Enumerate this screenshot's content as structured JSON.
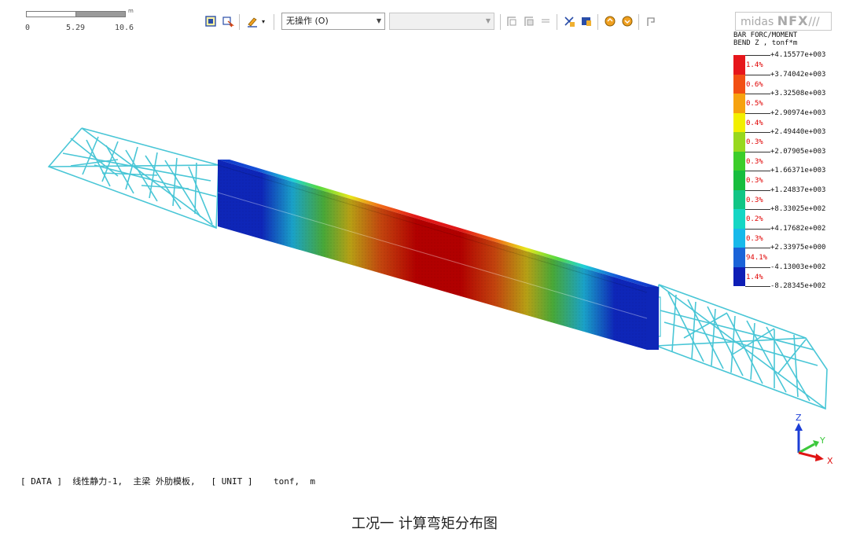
{
  "scale": {
    "labels": [
      "0",
      "5.29",
      "10.6"
    ],
    "unit": "m"
  },
  "toolbar": {
    "operation_value": "无操作 (O)",
    "icons": [
      "box-select-icon",
      "wireframe-icon",
      "edit-view-icon",
      "view-left-icon",
      "view-right-icon",
      "view-list-icon",
      "clear-icon",
      "select-element-icon",
      "rotate-icon",
      "rotate2-icon",
      "pin-icon"
    ]
  },
  "logo": {
    "prefix": "midas ",
    "brand": "NFX",
    "suffix": "///"
  },
  "legend": {
    "title_line1": "BAR FORC/MOMENT",
    "title_line2": "BEND Z , tonf*m",
    "values": [
      "+4.15577e+003",
      "+3.74042e+003",
      "+3.32508e+003",
      "+2.90974e+003",
      "+2.49440e+003",
      "+2.07905e+003",
      "+1.66371e+003",
      "+1.24837e+003",
      "+8.33025e+002",
      "+4.17682e+002",
      "+2.33975e+000",
      "-4.13003e+002",
      "-8.28345e+002"
    ],
    "percents": [
      "1.4%",
      "0.6%",
      "0.5%",
      "0.4%",
      "0.3%",
      "0.3%",
      "0.3%",
      "0.3%",
      "0.2%",
      "0.3%",
      "94.1%",
      "1.4%"
    ],
    "colors": [
      "#e6161b",
      "#f24f13",
      "#f6a20f",
      "#f2ef00",
      "#98d81e",
      "#3ccd2a",
      "#18bd3e",
      "#12c585",
      "#16d6c4",
      "#18b9ea",
      "#1a63d8",
      "#0e1eb6"
    ]
  },
  "axes": {
    "z": "Z",
    "y": "Y",
    "x": "X",
    "colors": {
      "z": "#1c3ed6",
      "y": "#3cc83c",
      "x": "#e01414"
    }
  },
  "status": {
    "data_tag": "[ DATA ]",
    "case": "线性静力-1,",
    "part": "主梁 外肋模板,",
    "unit_tag": "[ UNIT ]",
    "unit": "tonf,  m"
  },
  "caption": "工况一  计算弯矩分布图",
  "colors": {
    "truss": "#49c6d6",
    "beam_low": "#0e26b8",
    "beam_high": "#b50000"
  }
}
